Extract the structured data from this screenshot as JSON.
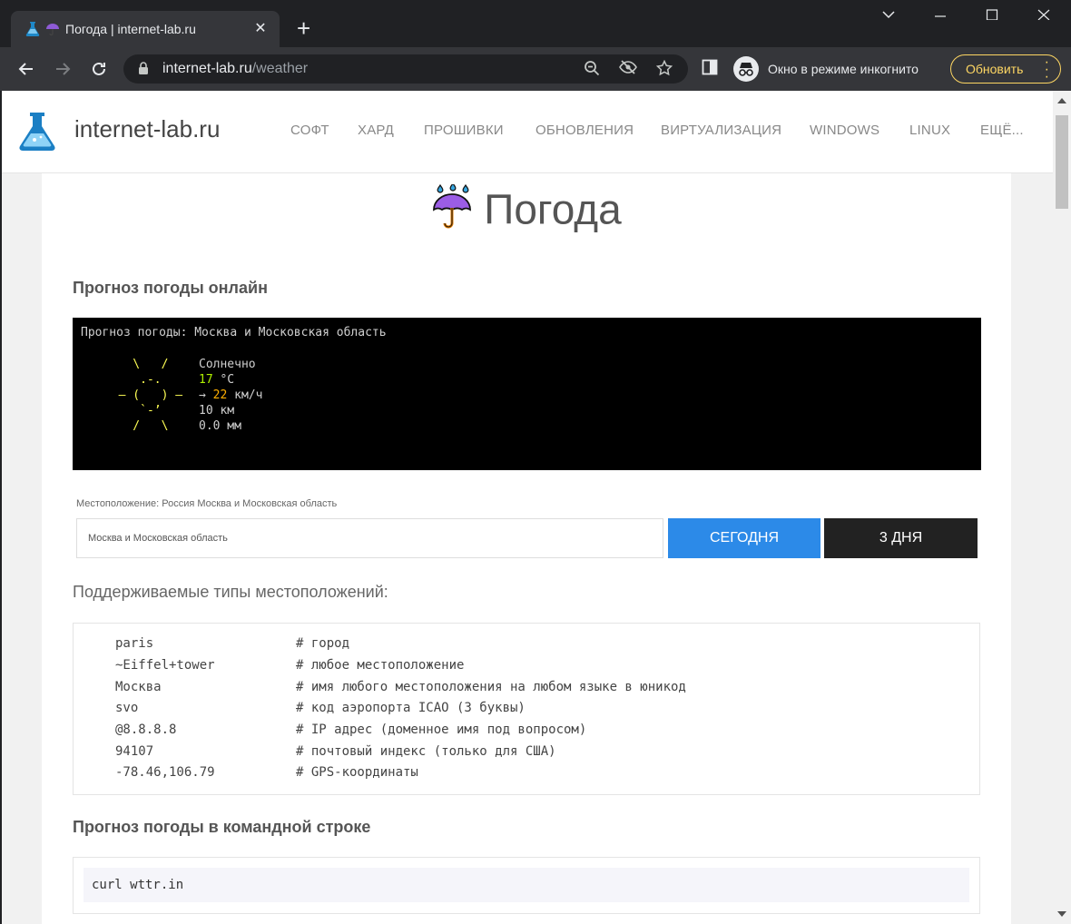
{
  "browser": {
    "tab_title": "Погода | internet-lab.ru",
    "url_host": "internet-lab.ru",
    "url_path": "/weather",
    "incognito_label": "Окно в режиме инкогнито",
    "update_label": "Обновить",
    "accent_update": "#fdd663"
  },
  "site": {
    "name": "internet-lab.ru",
    "nav": [
      "СОФТ",
      "ХАРД",
      "ПРОШИВКИ",
      "ОБНОВЛЕНИЯ",
      "ВИРТУАЛИЗАЦИЯ",
      "WINDOWS",
      "LINUX",
      "ЕЩЁ..."
    ]
  },
  "page": {
    "title": "Погода",
    "forecast_heading": "Прогноз погоды онлайн",
    "terminal": {
      "header": "Прогноз погоды: Москва и Московская область",
      "condition": "Солнечно",
      "temp": "17",
      "temp_unit": " °C",
      "wind_arrow": "→ ",
      "wind": "22",
      "wind_unit": " км/ч",
      "visibility": "10 км",
      "precip": "0.0 мм"
    },
    "location_label": "Местоположение: Россия  Москва и Московская область",
    "location_input_value": "Москва и Московская область",
    "btn_today": "СЕГОДНЯ",
    "btn_3days": "3 ДНЯ",
    "types_heading": "Поддерживаемые типы местоположений:",
    "types": [
      {
        "key": "paris",
        "desc": "# город"
      },
      {
        "key": "~Eiffel+tower",
        "desc": "# любое местоположение"
      },
      {
        "key": "Москва",
        "desc": "# имя любого местоположения на любом языке в юникод"
      },
      {
        "key": "svo",
        "desc": "# код аэропорта ICAO (3 буквы)"
      },
      {
        "key": "@8.8.8.8",
        "desc": "# IP адрес (доменное имя под вопросом)"
      },
      {
        "key": "94107",
        "desc": "# почтовый индекс (только для США)"
      },
      {
        "key": "-78.46,106.79",
        "desc": "# GPS-координаты"
      }
    ],
    "cli_heading": "Прогноз погоды в командной строке",
    "cli_code": "curl wttr.in"
  }
}
